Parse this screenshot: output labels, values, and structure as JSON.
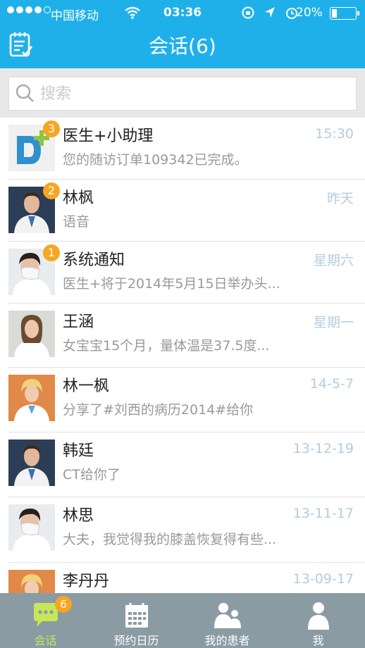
{
  "status_bar": {
    "carrier": "中国移动",
    "time": "03:36",
    "battery": "20%"
  },
  "header": {
    "title": "会话(6)"
  },
  "search": {
    "placeholder": "搜索",
    "value": ""
  },
  "conversations": [
    {
      "name": "医生+小助理",
      "message": "您的随访订单109342已完成。",
      "time": "15:30",
      "badge": "3",
      "avatar": "doctor-plus-logo-icon"
    },
    {
      "name": "林枫",
      "message": "语音",
      "time": "昨天",
      "badge": "2",
      "avatar": "male-doctor-avatar"
    },
    {
      "name": "系统通知",
      "message": "医生+将于2014年5月15日举办头...",
      "time": "星期六",
      "badge": "1",
      "avatar": "masked-doctor-avatar"
    },
    {
      "name": "王涵",
      "message": "女宝宝15个月，量体温是37.5度...",
      "time": "星期一",
      "badge": "",
      "avatar": "female-doctor-avatar"
    },
    {
      "name": "林一枫",
      "message": "分享了#刘西的病历2014#给你",
      "time": "14-5-7",
      "badge": "",
      "avatar": "blonde-doctor-avatar"
    },
    {
      "name": "韩廷",
      "message": "CT给你了",
      "time": "13-12-19",
      "badge": "",
      "avatar": "male-doctor-avatar"
    },
    {
      "name": "林思",
      "message": "大夫，我觉得我的膝盖恢复得有些...",
      "time": "13-11-17",
      "badge": "",
      "avatar": "masked-doctor-avatar"
    },
    {
      "name": "李丹丹",
      "message": "",
      "time": "13-09-17",
      "badge": "",
      "avatar": "blonde-doctor-avatar"
    }
  ],
  "tabbar": {
    "tabs": [
      {
        "label": "会话",
        "badge": "6",
        "icon": "chat-bubble-icon"
      },
      {
        "label": "预约日历",
        "icon": "calendar-icon"
      },
      {
        "label": "我的患者",
        "icon": "patients-icon"
      },
      {
        "label": "我",
        "icon": "person-icon"
      }
    ]
  },
  "colors": {
    "header": "#1fb0ea",
    "badge": "#f5a623",
    "tabbar": "#8a9ba3",
    "active_tab": "#c8e65a"
  }
}
